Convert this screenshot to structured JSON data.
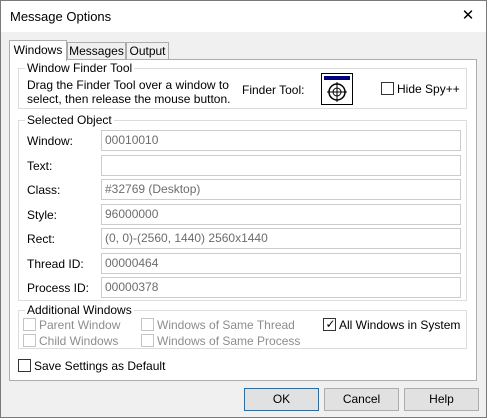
{
  "window": {
    "title": "Message Options",
    "close_glyph": "✕"
  },
  "tabs": [
    {
      "label": "Windows",
      "active": true
    },
    {
      "label": "Messages",
      "active": false
    },
    {
      "label": "Output",
      "active": false
    }
  ],
  "finder_group": {
    "legend": "Window Finder Tool",
    "line1": "Drag the Finder Tool over a window to",
    "line2": "select, then release the mouse button.",
    "finder_label": "Finder Tool:",
    "finder_icon": "crosshair-target-icon",
    "hide_spy_label": "Hide Spy++",
    "hide_spy_checked": false
  },
  "selected_object": {
    "legend": "Selected Object",
    "fields": [
      {
        "label": "Window:",
        "value": "00010010"
      },
      {
        "label": "Text:",
        "value": ""
      },
      {
        "label": "Class:",
        "value": "#32769 (Desktop)"
      },
      {
        "label": "Style:",
        "value": "96000000"
      },
      {
        "label": "Rect:",
        "value": "(0, 0)-(2560, 1440) 2560x1440"
      },
      {
        "label": "Thread ID:",
        "value": "00000464"
      },
      {
        "label": "Process ID:",
        "value": "00000378"
      }
    ]
  },
  "additional_windows": {
    "legend": "Additional Windows",
    "parent_window": "Parent Window",
    "child_windows": "Child Windows",
    "same_thread": "Windows of Same Thread",
    "same_process": "Windows of Same Process",
    "all_windows": "All Windows in System",
    "all_windows_checked": true
  },
  "save_settings": {
    "label": "Save Settings as Default",
    "checked": false
  },
  "buttons": {
    "ok": "OK",
    "cancel": "Cancel",
    "help": "Help"
  },
  "colors": {
    "accent": "#0078d7",
    "finder_bar": "#000080",
    "disabled_text": "#8d8d8d"
  }
}
